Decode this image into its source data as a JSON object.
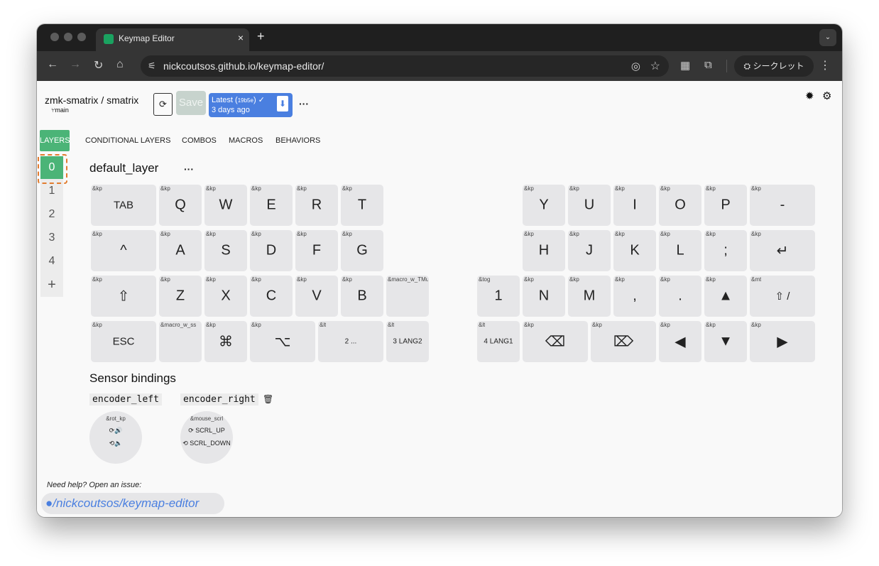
{
  "browser": {
    "tab_title": "Keymap Editor",
    "tab_close": "×",
    "new_tab": "+",
    "tab_menu": "⌄",
    "url": "nickcoutsos.github.io/keymap-editor/",
    "incognito_label": "⛭ シークレット",
    "icons": {
      "back": "←",
      "forward": "→",
      "reload": "↻",
      "home": "⌂",
      "tune": "⚟",
      "eye": "◎",
      "star": "☆",
      "qr": "▦",
      "extensions": "⧉",
      "menu": "⋮"
    }
  },
  "header": {
    "repo": "zmk-smatrix / smatrix",
    "branch": "⑂main",
    "sync_icon": "⟳",
    "save_label": "Save",
    "latest_label": "Latest (",
    "latest_sha": "19b5e",
    "latest_check": ") ✓",
    "latest_time": "3 days ago",
    "download_icon": "⬇",
    "more": "···",
    "bug_icon": "✹",
    "gear_icon": "⚙"
  },
  "nav_tabs": [
    "LAYERS",
    "CONDITIONAL LAYERS",
    "COMBOS",
    "MACROS",
    "BEHAVIORS"
  ],
  "layers": {
    "items": [
      "0",
      "1",
      "2",
      "3",
      "4",
      "+"
    ],
    "active_index": 0,
    "title": "default_layer",
    "more": "···"
  },
  "keys": [
    {
      "b": "&kp",
      "l": "TAB"
    },
    {
      "b": "&kp",
      "l": "Q"
    },
    {
      "b": "&kp",
      "l": "W"
    },
    {
      "b": "&kp",
      "l": "E"
    },
    {
      "b": "&kp",
      "l": "R"
    },
    {
      "b": "&kp",
      "l": "T"
    },
    {
      "b": "&kp",
      "l": "Y"
    },
    {
      "b": "&kp",
      "l": "U"
    },
    {
      "b": "&kp",
      "l": "I"
    },
    {
      "b": "&kp",
      "l": "O"
    },
    {
      "b": "&kp",
      "l": "P"
    },
    {
      "b": "&kp",
      "l": "-"
    },
    {
      "b": "&kp",
      "l": "^"
    },
    {
      "b": "&kp",
      "l": "A"
    },
    {
      "b": "&kp",
      "l": "S"
    },
    {
      "b": "&kp",
      "l": "D"
    },
    {
      "b": "&kp",
      "l": "F"
    },
    {
      "b": "&kp",
      "l": "G"
    },
    {
      "b": "&kp",
      "l": "H"
    },
    {
      "b": "&kp",
      "l": "J"
    },
    {
      "b": "&kp",
      "l": "K"
    },
    {
      "b": "&kp",
      "l": "L"
    },
    {
      "b": "&kp",
      "l": ";"
    },
    {
      "b": "&kp",
      "l": "↵"
    },
    {
      "b": "&kp",
      "l": "⇧"
    },
    {
      "b": "&kp",
      "l": "Z"
    },
    {
      "b": "&kp",
      "l": "X"
    },
    {
      "b": "&kp",
      "l": "C"
    },
    {
      "b": "&kp",
      "l": "V"
    },
    {
      "b": "&kp",
      "l": "B"
    },
    {
      "b": "&macro_w_TMute",
      "l": ""
    },
    {
      "b": "&tog",
      "l": "1"
    },
    {
      "b": "&kp",
      "l": "N"
    },
    {
      "b": "&kp",
      "l": "M"
    },
    {
      "b": "&kp",
      "l": ","
    },
    {
      "b": "&kp",
      "l": "."
    },
    {
      "b": "&kp",
      "l": "▲"
    },
    {
      "b": "&mt",
      "l": "⇧ /"
    },
    {
      "b": "&kp",
      "l": "ESC"
    },
    {
      "b": "&macro_w_ss",
      "l": ""
    },
    {
      "b": "&kp",
      "l": "⌘"
    },
    {
      "b": "&kp",
      "l": "⌥"
    },
    {
      "b": "&lt",
      "l": "2 ..."
    },
    {
      "b": "&lt",
      "l": "3 LANG2"
    },
    {
      "b": "&lt",
      "l": "4 LANG1"
    },
    {
      "b": "&kp",
      "l": "⌫"
    },
    {
      "b": "&kp",
      "l": "⌦"
    },
    {
      "b": "&kp",
      "l": "◀"
    },
    {
      "b": "&kp",
      "l": "▼"
    },
    {
      "b": "&kp",
      "l": "▶"
    }
  ],
  "sensors": {
    "title": "Sensor bindings",
    "encoders": [
      {
        "name": "encoder_left",
        "behavior": "&rot_kp",
        "up": "⟳🔊",
        "down": "⟲🔈"
      },
      {
        "name": "encoder_right",
        "behavior": "&mouse_scrl",
        "up": "⟳ SCRL_UP",
        "down": "⟲ SCRL_DOWN"
      }
    ],
    "trash_icon": "🗑"
  },
  "footer": {
    "help_text": "Need help? Open an issue:",
    "repo_link": "/nickcoutsos/keymap-editor",
    "github_icon": "●"
  }
}
